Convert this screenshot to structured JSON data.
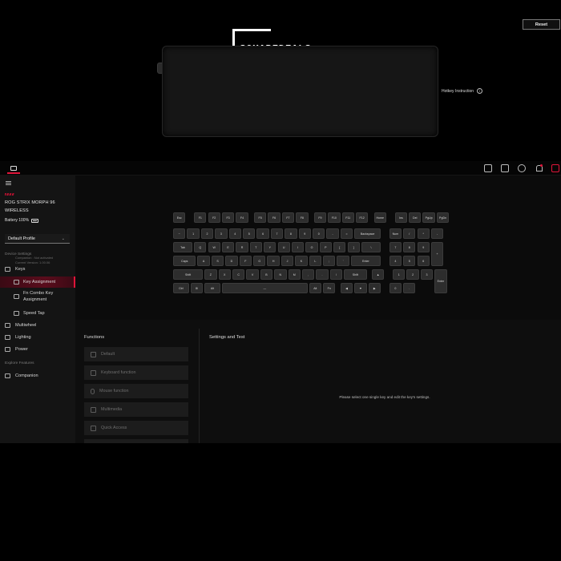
{
  "logo": {
    "text": "SQUAREDEALS"
  },
  "sidebar": {
    "device_name": "ROG STRIX MORPH 96 WIRELESS",
    "battery": "Battery 100%",
    "profile": "Default Profile",
    "device_settings_label": "Device Settings",
    "items": [
      {
        "label": "Keys"
      },
      {
        "label": "Key Assignment"
      },
      {
        "label": "Fn Combo Key Assignment"
      },
      {
        "label": "Speed Tap"
      },
      {
        "label": "Multiwheel"
      },
      {
        "label": "Lighting"
      },
      {
        "label": "Power"
      }
    ],
    "explore_label": "Explore Features",
    "companion": "Companion",
    "footer_line1": "Companion : Not activated",
    "footer_line2": "Current Version: 1.00.06"
  },
  "toolbar": {
    "reset_label": "Reset"
  },
  "hotkey_label": "Hotkey Instruction",
  "keyboard": {
    "row1": [
      "Esc",
      "F1",
      "F2",
      "F3",
      "F4",
      "F5",
      "F6",
      "F7",
      "F8",
      "F9",
      "F10",
      "F11",
      "F12",
      "Home",
      "Ins",
      "Del",
      "PgUp",
      "PgDn"
    ],
    "row2": [
      "~",
      "1",
      "2",
      "3",
      "4",
      "5",
      "6",
      "7",
      "8",
      "9",
      "0",
      "-",
      "=",
      "Backspace",
      "Num",
      "/",
      "*",
      "-"
    ],
    "row3": [
      "Tab",
      "Q",
      "W",
      "E",
      "R",
      "T",
      "Y",
      "U",
      "I",
      "O",
      "P",
      "[",
      "]",
      "\\",
      "7",
      "8",
      "9",
      "+"
    ],
    "row4": [
      "Caps",
      "A",
      "S",
      "D",
      "F",
      "G",
      "H",
      "J",
      "K",
      "L",
      ";",
      "'",
      "Enter",
      "4",
      "5",
      "6"
    ],
    "row5": [
      "Shift",
      "Z",
      "X",
      "C",
      "V",
      "B",
      "N",
      "M",
      ",",
      ".",
      "/",
      "Shift",
      "▲",
      "1",
      "2",
      "3",
      "Enter"
    ],
    "row6": [
      "Ctrl",
      "⊞",
      "Alt",
      "—",
      "Alt",
      "Fn",
      "◀",
      "▼",
      "▶",
      "0",
      "."
    ]
  },
  "functions": {
    "title": "Functions",
    "items": [
      "Default",
      "Keyboard function",
      "Mouse function",
      "Multimedia",
      "Quick Access"
    ]
  },
  "settings": {
    "title": "Settings and Test",
    "message": "Please select one single key and edit the key's settings."
  },
  "colors": {
    "accent": "#e0153a",
    "background": "#000000",
    "panel": "#141414"
  }
}
